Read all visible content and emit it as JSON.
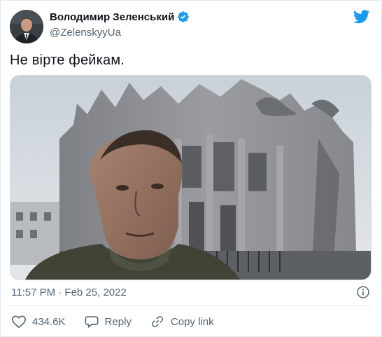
{
  "author": {
    "display_name": "Володимир Зеленський",
    "handle": "@ZelenskyyUa"
  },
  "tweet": {
    "text": "Не вірте фейкам.",
    "timestamp": "11:57 PM · Feb 25, 2022"
  },
  "actions": {
    "likes": "434.6K",
    "reply_label": "Reply",
    "copy_link_label": "Copy link"
  },
  "icons": [
    "avatar",
    "verified-badge-icon",
    "twitter-bird-icon",
    "info-icon",
    "heart-icon",
    "reply-icon",
    "link-icon"
  ],
  "colors": {
    "brand_blue": "#1d9bf0",
    "text_primary": "#0f1419",
    "text_secondary": "#536471",
    "border": "#e1e8ed"
  }
}
